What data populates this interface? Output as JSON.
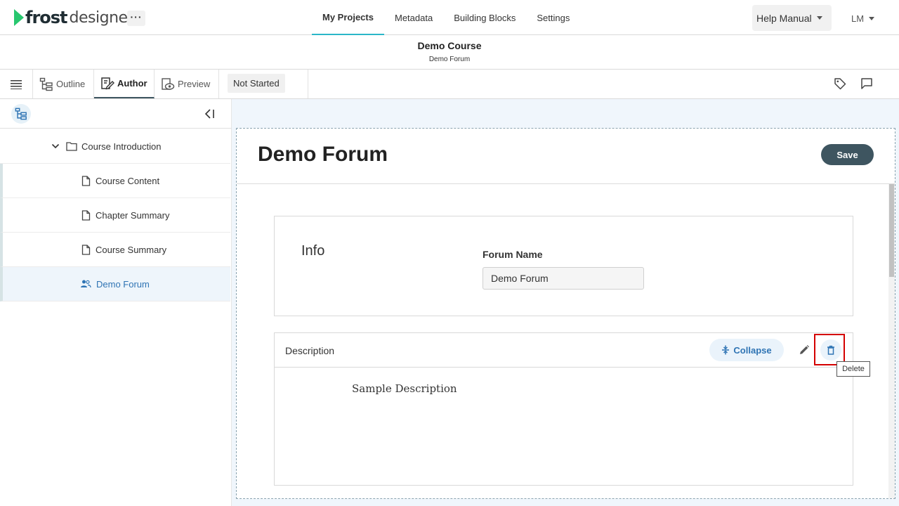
{
  "app": {
    "logo_bold": "frost",
    "logo_light": "designer",
    "more_label": "···"
  },
  "topnav": {
    "items": [
      {
        "label": "My Projects",
        "active": true
      },
      {
        "label": "Metadata",
        "active": false
      },
      {
        "label": "Building Blocks",
        "active": false
      },
      {
        "label": "Settings",
        "active": false
      }
    ],
    "help_label": "Help Manual",
    "user_initials": "LM"
  },
  "header": {
    "course_title": "Demo Course",
    "course_subtitle": "Demo Forum"
  },
  "toolbar": {
    "tabs": [
      {
        "label": "Outline",
        "icon": "outline-icon"
      },
      {
        "label": "Author",
        "icon": "author-icon",
        "active": true
      },
      {
        "label": "Preview",
        "icon": "preview-icon"
      }
    ],
    "status": "Not Started",
    "right_icons": [
      "tag-icon",
      "comment-icon"
    ]
  },
  "sidebar": {
    "items": [
      {
        "label": "Course Introduction",
        "type": "folder",
        "expanded": true
      },
      {
        "label": "Course Content",
        "type": "page"
      },
      {
        "label": "Chapter Summary",
        "type": "page"
      },
      {
        "label": "Course Summary",
        "type": "page"
      },
      {
        "label": "Demo Forum",
        "type": "forum",
        "selected": true
      }
    ]
  },
  "main": {
    "title": "Demo Forum",
    "save_label": "Save",
    "info": {
      "title": "Info",
      "forum_name_label": "Forum Name",
      "forum_name_value": "Demo Forum"
    },
    "description": {
      "title": "Description",
      "collapse_label": "Collapse",
      "body": "Sample Description",
      "tooltip": "Delete"
    }
  },
  "colors": {
    "accent": "#2bb6c8",
    "brand_green": "#28c76f",
    "primary_dark": "#3e5560",
    "link_blue": "#2f74b4",
    "highlight_red": "#d40000"
  }
}
